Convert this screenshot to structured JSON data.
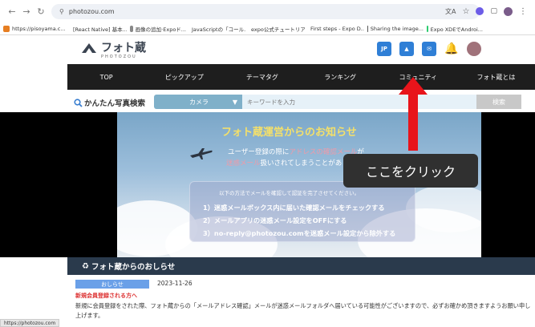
{
  "browser": {
    "url": "photozou.com",
    "bookmarks": [
      {
        "label": "https://pisoyama.c...",
        "color": "#e67e22"
      },
      {
        "label": "[React Native] 基本...",
        "color": "#2b6cb0"
      },
      {
        "label": "画像の追加·Expoド...",
        "color": "#888888"
      },
      {
        "label": "JavaScriptの「コール...",
        "color": "#d9534f"
      },
      {
        "label": "expo公式チュートリア...",
        "color": "#555555"
      },
      {
        "label": "First steps - Expo D...",
        "color": "#555555"
      },
      {
        "label": "Sharing the image...",
        "color": "#555555"
      },
      {
        "label": "Expo XDEでAndroi...",
        "color": "#2ecc71"
      }
    ]
  },
  "site": {
    "logo_text": "フォト蔵",
    "logo_sub": "PHOTOZOU",
    "header_icons": [
      {
        "name": "jp-icon",
        "label": "JP",
        "color": "#2f7fd6"
      },
      {
        "name": "upload-photo-icon",
        "label": "",
        "color": "#2f7fd6"
      },
      {
        "name": "messages-icon",
        "label": "",
        "color": "#2f7fd6"
      },
      {
        "name": "notification-bell-icon",
        "label": "",
        "color": "#e8a317"
      },
      {
        "name": "avatar",
        "label": "",
        "color": "#a0727a"
      }
    ]
  },
  "nav": [
    "TOP",
    "ピックアップ",
    "テーマタグ",
    "ランキング",
    "コミュニティ",
    "フォト蔵とは"
  ],
  "search": {
    "label": "かんたん写真検索",
    "category": "カメラ",
    "placeholder": "キーワードを入力",
    "button": "検索"
  },
  "banner": {
    "title": "フォト蔵運営からのお知らせ",
    "line1_a": "ユーザー登録の際に",
    "line1_b": "アドレスの確認メール",
    "line1_c": "が",
    "line2_a": "迷惑メール",
    "line2_b": "扱いされてしまうことがあります",
    "intro": "以下の方法でメールを確認して認証を完了させてください。",
    "items": [
      "1）迷惑メールボックス内に届いた確認メールをチェックする",
      "2）メールアプリの迷惑メール設定をOFFにする",
      "3）no-reply@photozou.comを迷惑メール設定から除外する"
    ]
  },
  "annotation": {
    "callout": "ここをクリック",
    "arrow_color": "#e8141b"
  },
  "news": {
    "section_title": "フォト蔵からのおしらせ",
    "badge": "おしらせ",
    "date": "2023-11-26",
    "headline": "新規会員登録される方へ",
    "body": "新規に会員登録をされた際、フォト蔵からの「メールアドレス確認」メールが迷惑メールフォルダへ届いている可能性がございますので、必ずお確かめ頂きますようお願い申し上げます。"
  },
  "status_url": "https://photozou.com"
}
